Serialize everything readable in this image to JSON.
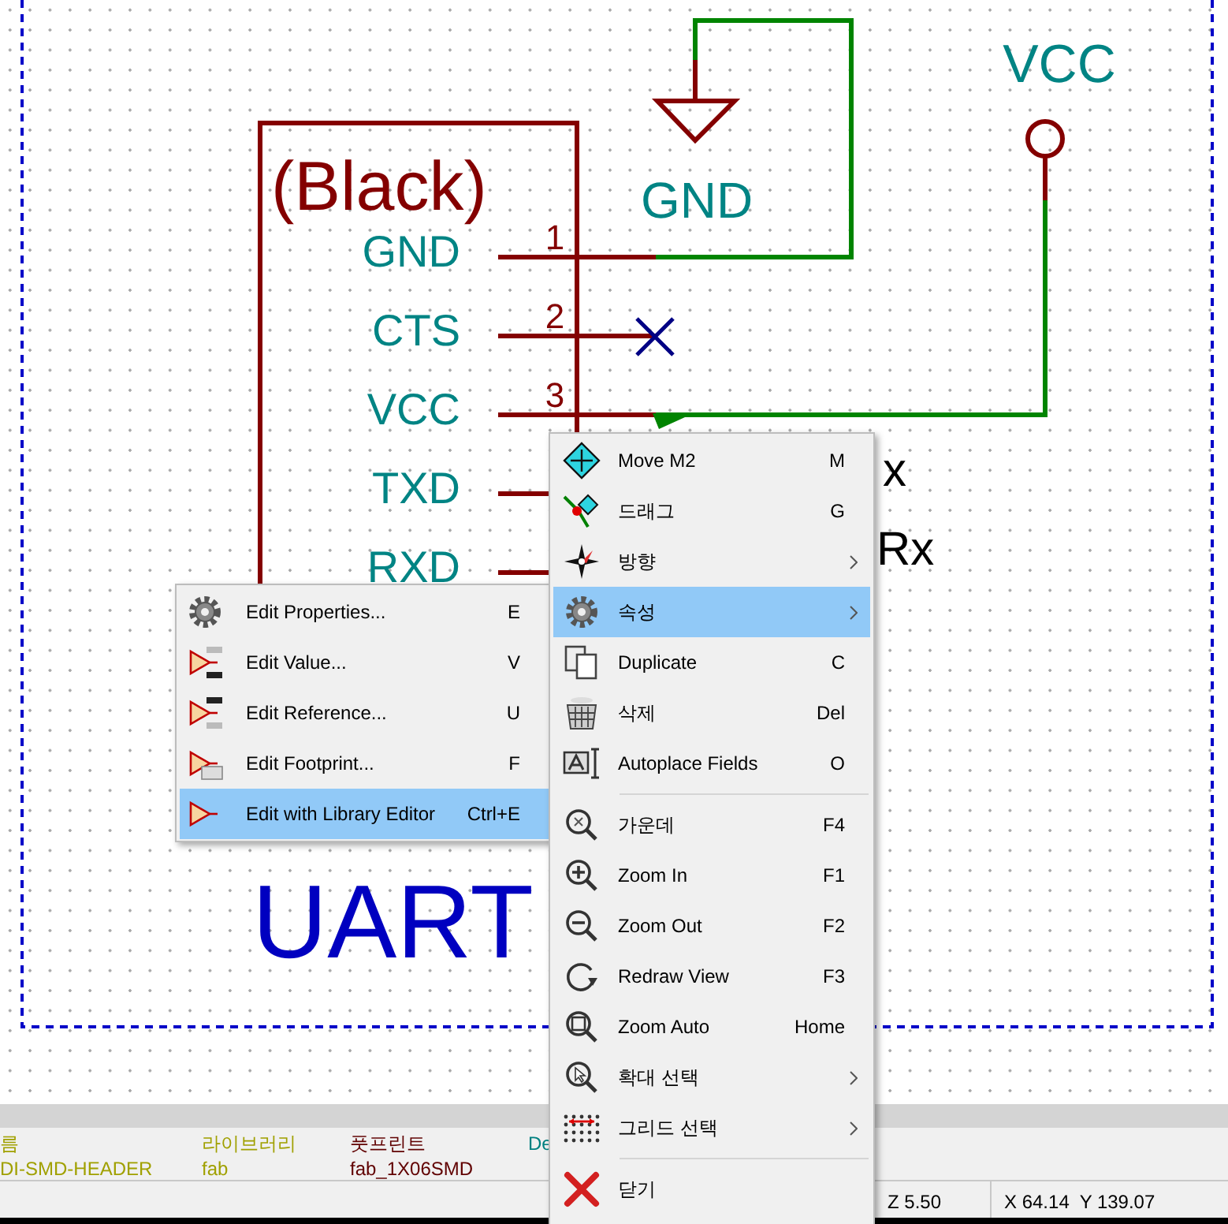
{
  "schematic": {
    "component_value": "(Black)",
    "pins": [
      {
        "name": "GND",
        "number": "1"
      },
      {
        "name": "CTS",
        "number": "2"
      },
      {
        "name": "VCC",
        "number": "3"
      },
      {
        "name": "TXD"
      },
      {
        "name": "RXD"
      }
    ],
    "power_symbols": [
      {
        "kind": "ground",
        "label": "GND"
      },
      {
        "kind": "supply",
        "label": "VCC"
      }
    ],
    "net_labels": [
      "x",
      "Rx"
    ],
    "sheet_text": "UART"
  },
  "context_menu": {
    "items": [
      {
        "kind": "item",
        "label": "Move M2",
        "shortcut": "M",
        "submenu": false,
        "selected": false
      },
      {
        "kind": "item",
        "label": "드래그",
        "shortcut": "G",
        "submenu": false,
        "selected": false
      },
      {
        "kind": "item",
        "label": "방향",
        "submenu": true,
        "selected": false
      },
      {
        "kind": "item",
        "label": "속성",
        "submenu": true,
        "selected": true
      },
      {
        "kind": "item",
        "label": "Duplicate",
        "shortcut": "C",
        "submenu": false,
        "selected": false
      },
      {
        "kind": "item",
        "label": "삭제",
        "shortcut": "Del",
        "submenu": false,
        "selected": false
      },
      {
        "kind": "item",
        "label": "Autoplace Fields",
        "shortcut": "O",
        "submenu": false,
        "selected": false
      },
      {
        "kind": "separator"
      },
      {
        "kind": "item",
        "label": "가운데",
        "shortcut": "F4",
        "submenu": false,
        "selected": false
      },
      {
        "kind": "item",
        "label": "Zoom In",
        "shortcut": "F1",
        "submenu": false,
        "selected": false
      },
      {
        "kind": "item",
        "label": "Zoom Out",
        "shortcut": "F2",
        "submenu": false,
        "selected": false
      },
      {
        "kind": "item",
        "label": "Redraw View",
        "shortcut": "F3",
        "submenu": false,
        "selected": false
      },
      {
        "kind": "item",
        "label": "Zoom Auto",
        "shortcut": "Home",
        "submenu": false,
        "selected": false
      },
      {
        "kind": "item",
        "label": "확대 선택",
        "submenu": true,
        "selected": false
      },
      {
        "kind": "item",
        "label": "그리드 선택",
        "submenu": true,
        "selected": false
      },
      {
        "kind": "separator"
      },
      {
        "kind": "item",
        "label": "닫기",
        "submenu": false,
        "selected": false
      }
    ]
  },
  "submenu": {
    "items": [
      {
        "label": "Edit Properties...",
        "shortcut": "E",
        "selected": false
      },
      {
        "label": "Edit Value...",
        "shortcut": "V",
        "selected": false
      },
      {
        "label": "Edit Reference...",
        "shortcut": "U",
        "selected": false
      },
      {
        "label": "Edit Footprint...",
        "shortcut": "F",
        "selected": false
      },
      {
        "label": "Edit with Library Editor",
        "shortcut": "Ctrl+E",
        "selected": true
      }
    ]
  },
  "info_panel": {
    "columns": [
      {
        "header": "름",
        "value": "DI-SMD-HEADER",
        "color": "#a0a000"
      },
      {
        "header": "라이브러리",
        "value": "fab",
        "color": "#a0a000"
      },
      {
        "header": "풋프린트",
        "value": "fab_1X06SMD",
        "color": "#600000"
      },
      {
        "header": "De",
        "color": "#008080"
      }
    ]
  },
  "status_bar": [
    "Z 5.50",
    "X 64.14  Y 139.07"
  ]
}
